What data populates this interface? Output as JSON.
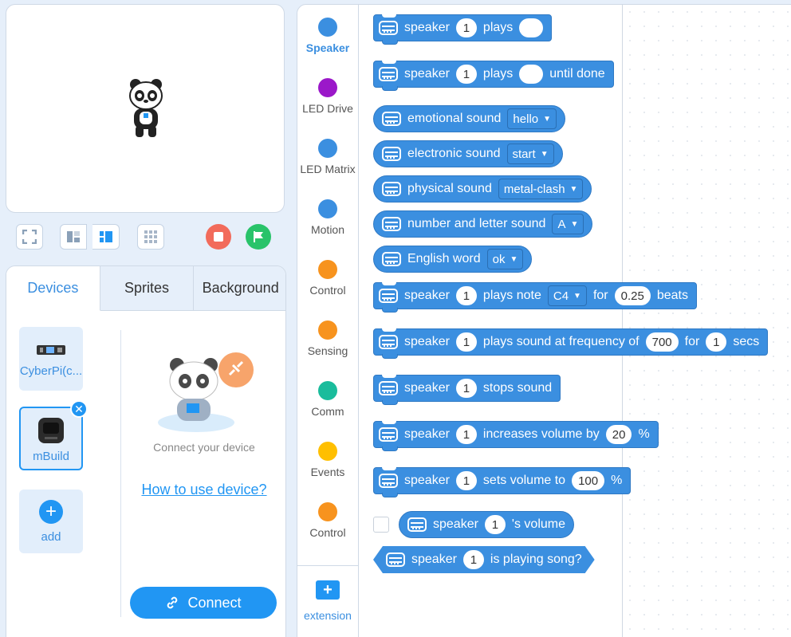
{
  "stage_toolbar": {
    "fullscreen_icon": "fullscreen-icon",
    "layout_icons": [
      "layout-small-icon",
      "layout-large-icon",
      "grid-icon"
    ],
    "colors": {
      "stop": "#f26b5b",
      "go": "#29c36a"
    }
  },
  "device_panel": {
    "tabs": [
      {
        "label": "Devices"
      },
      {
        "label": "Sprites"
      },
      {
        "label": "Background"
      }
    ],
    "devices": [
      {
        "label": "CyberPi(c..."
      },
      {
        "label": "mBuild"
      }
    ],
    "add_label": "add",
    "connect_hint": "Connect your device",
    "howto_link": "How to use device?",
    "connect_button": "Connect"
  },
  "categories": [
    {
      "label": "Speaker",
      "color": "#3b8fe0"
    },
    {
      "label": "LED Drive",
      "color": "#9b18c9"
    },
    {
      "label": "LED Matrix",
      "color": "#3b8fe0"
    },
    {
      "label": "Motion",
      "color": "#3b8fe0"
    },
    {
      "label": "Control",
      "color": "#f7931e"
    },
    {
      "label": "Sensing",
      "color": "#f7931e"
    },
    {
      "label": "Comm",
      "color": "#1abc9c"
    },
    {
      "label": "Events",
      "color": "#ffbf00"
    },
    {
      "label": "Control",
      "color": "#f7931e"
    }
  ],
  "extension_label": "extension",
  "blocks": {
    "b1": {
      "t1": "speaker",
      "v1": "1",
      "t2": "plays"
    },
    "b2": {
      "t1": "speaker",
      "v1": "1",
      "t2": "plays",
      "t3": "until done"
    },
    "b3": {
      "t1": "emotional sound",
      "dd": "hello"
    },
    "b4": {
      "t1": "electronic sound",
      "dd": "start"
    },
    "b5": {
      "t1": "physical sound",
      "dd": "metal-clash"
    },
    "b6": {
      "t1": "number and letter sound",
      "dd": "A"
    },
    "b7": {
      "t1": "English word",
      "dd": "ok"
    },
    "b8": {
      "t1": "speaker",
      "v1": "1",
      "t2": "plays note",
      "dd": "C4",
      "t3": "for",
      "v2": "0.25",
      "t4": "beats"
    },
    "b9": {
      "t1": "speaker",
      "v1": "1",
      "t2": "plays sound at frequency of",
      "v2": "700",
      "t3": "for",
      "v3": "1",
      "t4": "secs"
    },
    "b10": {
      "t1": "speaker",
      "v1": "1",
      "t2": "stops sound"
    },
    "b11": {
      "t1": "speaker",
      "v1": "1",
      "t2": "increases volume by",
      "v2": "20",
      "t3": "%"
    },
    "b12": {
      "t1": "speaker",
      "v1": "1",
      "t2": "sets volume to",
      "v2": "100",
      "t3": "%"
    },
    "b13": {
      "t1": "speaker",
      "v1": "1",
      "t2": "'s volume"
    },
    "b14": {
      "t1": "speaker",
      "v1": "1",
      "t2": "is playing song?"
    }
  }
}
